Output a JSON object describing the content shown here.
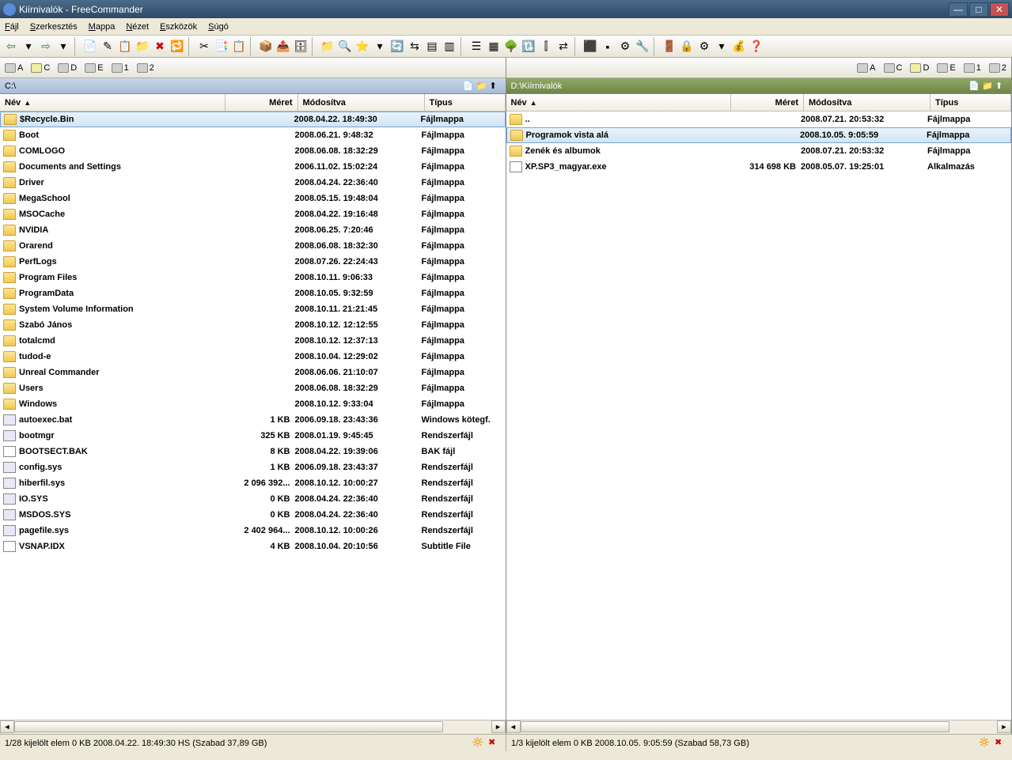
{
  "title": "Kiírnivalók - FreeCommander",
  "menu": [
    "Fájl",
    "Szerkesztés",
    "Mappa",
    "Nézet",
    "Eszközök",
    "Súgó"
  ],
  "drives_left": [
    {
      "label": "A"
    },
    {
      "label": "C",
      "active": true
    },
    {
      "label": "D"
    },
    {
      "label": "E"
    },
    {
      "label": "1"
    },
    {
      "label": "2"
    }
  ],
  "drives_right": [
    {
      "label": "A"
    },
    {
      "label": "C"
    },
    {
      "label": "D",
      "active": true
    },
    {
      "label": "E"
    },
    {
      "label": "1"
    },
    {
      "label": "2"
    }
  ],
  "left": {
    "path": "C:\\",
    "headers": {
      "name": "Név",
      "size": "Méret",
      "mod": "Módosítva",
      "type": "Típus"
    },
    "items": [
      {
        "name": "$Recycle.Bin",
        "size": "",
        "mod": "2008.04.22. 18:49:30",
        "type": "Fájlmappa",
        "icon": "folder",
        "sel": true
      },
      {
        "name": "Boot",
        "size": "",
        "mod": "2008.06.21. 9:48:32",
        "type": "Fájlmappa",
        "icon": "folder"
      },
      {
        "name": "COMLOGO",
        "size": "",
        "mod": "2008.06.08. 18:32:29",
        "type": "Fájlmappa",
        "icon": "folder"
      },
      {
        "name": "Documents and Settings",
        "size": "",
        "mod": "2006.11.02. 15:02:24",
        "type": "Fájlmappa",
        "icon": "folder"
      },
      {
        "name": "Driver",
        "size": "",
        "mod": "2008.04.24. 22:36:40",
        "type": "Fájlmappa",
        "icon": "folder"
      },
      {
        "name": "MegaSchool",
        "size": "",
        "mod": "2008.05.15. 19:48:04",
        "type": "Fájlmappa",
        "icon": "folder"
      },
      {
        "name": "MSOCache",
        "size": "",
        "mod": "2008.04.22. 19:16:48",
        "type": "Fájlmappa",
        "icon": "folder"
      },
      {
        "name": "NVIDIA",
        "size": "",
        "mod": "2008.06.25. 7:20:46",
        "type": "Fájlmappa",
        "icon": "folder"
      },
      {
        "name": "Orarend",
        "size": "",
        "mod": "2008.06.08. 18:32:30",
        "type": "Fájlmappa",
        "icon": "folder"
      },
      {
        "name": "PerfLogs",
        "size": "",
        "mod": "2008.07.26. 22:24:43",
        "type": "Fájlmappa",
        "icon": "folder"
      },
      {
        "name": "Program Files",
        "size": "",
        "mod": "2008.10.11. 9:06:33",
        "type": "Fájlmappa",
        "icon": "folder"
      },
      {
        "name": "ProgramData",
        "size": "",
        "mod": "2008.10.05. 9:32:59",
        "type": "Fájlmappa",
        "icon": "folder"
      },
      {
        "name": "System Volume Information",
        "size": "",
        "mod": "2008.10.11. 21:21:45",
        "type": "Fájlmappa",
        "icon": "folder"
      },
      {
        "name": "Szabó János",
        "size": "",
        "mod": "2008.10.12. 12:12:55",
        "type": "Fájlmappa",
        "icon": "folder"
      },
      {
        "name": "totalcmd",
        "size": "",
        "mod": "2008.10.12. 12:37:13",
        "type": "Fájlmappa",
        "icon": "folder"
      },
      {
        "name": "tudod-e",
        "size": "",
        "mod": "2008.10.04. 12:29:02",
        "type": "Fájlmappa",
        "icon": "folder"
      },
      {
        "name": "Unreal Commander",
        "size": "",
        "mod": "2008.06.06. 21:10:07",
        "type": "Fájlmappa",
        "icon": "folder"
      },
      {
        "name": "Users",
        "size": "",
        "mod": "2008.06.08. 18:32:29",
        "type": "Fájlmappa",
        "icon": "folder"
      },
      {
        "name": "Windows",
        "size": "",
        "mod": "2008.10.12. 9:33:04",
        "type": "Fájlmappa",
        "icon": "folder"
      },
      {
        "name": "autoexec.bat",
        "size": "1 KB",
        "mod": "2006.09.18. 23:43:36",
        "type": "Windows kötegf.",
        "icon": "sys"
      },
      {
        "name": "bootmgr",
        "size": "325 KB",
        "mod": "2008.01.19. 9:45:45",
        "type": "Rendszerfájl",
        "icon": "sys"
      },
      {
        "name": "BOOTSECT.BAK",
        "size": "8 KB",
        "mod": "2008.04.22. 19:39:06",
        "type": "BAK fájl",
        "icon": "doc"
      },
      {
        "name": "config.sys",
        "size": "1 KB",
        "mod": "2006.09.18. 23:43:37",
        "type": "Rendszerfájl",
        "icon": "sys"
      },
      {
        "name": "hiberfil.sys",
        "size": "2 096 392...",
        "mod": "2008.10.12. 10:00:27",
        "type": "Rendszerfájl",
        "icon": "sys"
      },
      {
        "name": "IO.SYS",
        "size": "0 KB",
        "mod": "2008.04.24. 22:36:40",
        "type": "Rendszerfájl",
        "icon": "sys"
      },
      {
        "name": "MSDOS.SYS",
        "size": "0 KB",
        "mod": "2008.04.24. 22:36:40",
        "type": "Rendszerfájl",
        "icon": "sys"
      },
      {
        "name": "pagefile.sys",
        "size": "2 402 964...",
        "mod": "2008.10.12. 10:00:26",
        "type": "Rendszerfájl",
        "icon": "sys"
      },
      {
        "name": "VSNAP.IDX",
        "size": "4 KB",
        "mod": "2008.10.04. 20:10:56",
        "type": "Subtitle File",
        "icon": "doc"
      }
    ],
    "status": "1/28 kijelölt elem   0 KB   2008.04.22. 18:49:30   HS   (Szabad 37,89 GB)"
  },
  "right": {
    "path": "D:\\Kiírnivalók",
    "headers": {
      "name": "Név",
      "size": "Méret",
      "mod": "Módosítva",
      "type": "Típus"
    },
    "items": [
      {
        "name": "..",
        "size": "",
        "mod": "2008.07.21. 20:53:32",
        "type": "Fájlmappa",
        "icon": "folder"
      },
      {
        "name": "Programok vista alá",
        "size": "",
        "mod": "2008.10.05. 9:05:59",
        "type": "Fájlmappa",
        "icon": "folder",
        "sel": true
      },
      {
        "name": "Zenék és albumok",
        "size": "",
        "mod": "2008.07.21. 20:53:32",
        "type": "Fájlmappa",
        "icon": "folder"
      },
      {
        "name": "XP.SP3_magyar.exe",
        "size": "314 698 KB",
        "mod": "2008.05.07. 19:25:01",
        "type": "Alkalmazás",
        "icon": "doc"
      }
    ],
    "status": "1/3 kijelölt elem   0 KB   2008.10.05. 9:05:59   (Szabad 58,73 GB)"
  }
}
